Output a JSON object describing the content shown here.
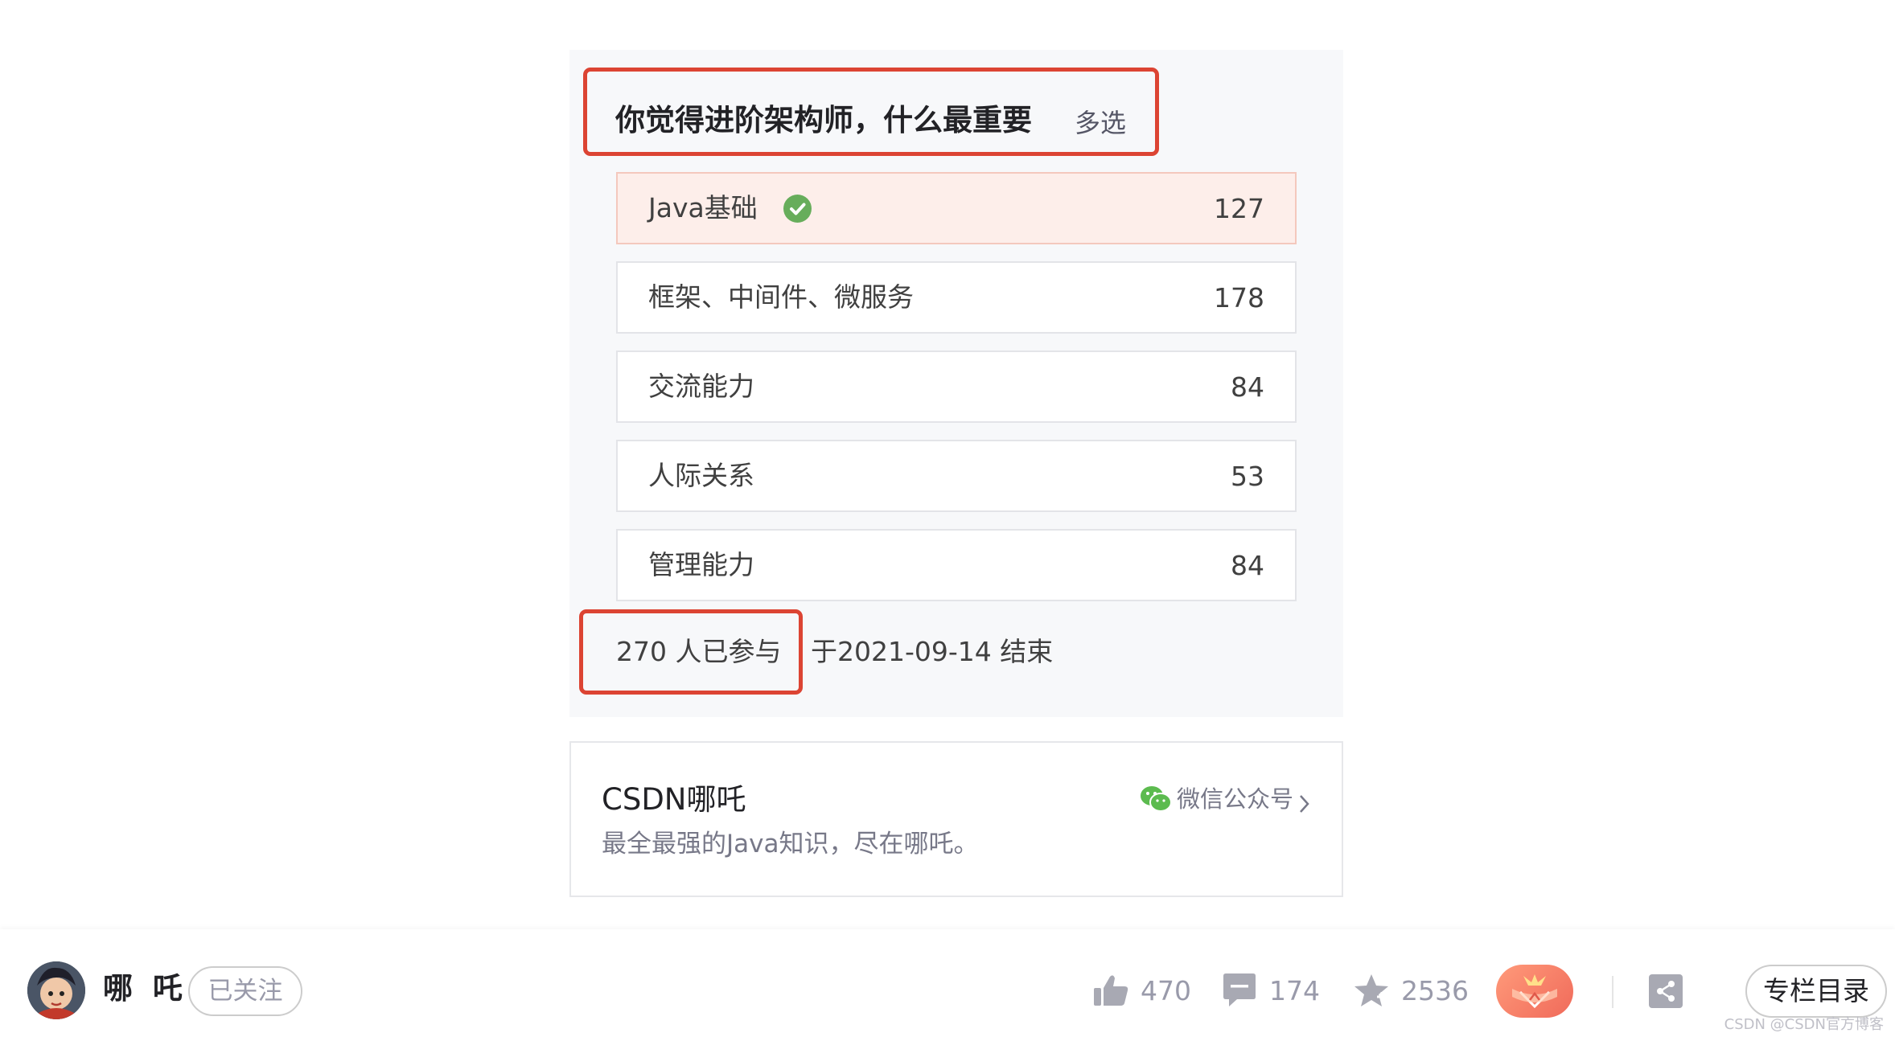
{
  "vote": {
    "title": "你觉得进阶架构师，什么最重要",
    "mode": "多选",
    "options": [
      {
        "label": "Java基础",
        "count": "127",
        "selected": true
      },
      {
        "label": "框架、中间件、微服务",
        "count": "178",
        "selected": false
      },
      {
        "label": "交流能力",
        "count": "84",
        "selected": false
      },
      {
        "label": "人际关系",
        "count": "53",
        "selected": false
      },
      {
        "label": "管理能力",
        "count": "84",
        "selected": false
      }
    ],
    "participants": "270 人已参与",
    "end_text": "于2021-09-14 结束",
    "highlight_color": "#dc4433",
    "check_color": "#67ad5b"
  },
  "account": {
    "name": "CSDN哪吒",
    "description": "最全最强的Java知识，尽在哪吒。",
    "link_label": "微信公众号",
    "link_icon": "wechat-icon"
  },
  "toolbar": {
    "author": "哪 吒",
    "follow_label": "已关注",
    "likes": "470",
    "comments": "174",
    "favorites": "2536",
    "toc_label": "专栏目录",
    "icons": [
      "thumbs-up-icon",
      "comment-icon",
      "star-icon",
      "reward-icon",
      "share-icon"
    ]
  },
  "watermark": "CSDN @CSDN官方博客"
}
